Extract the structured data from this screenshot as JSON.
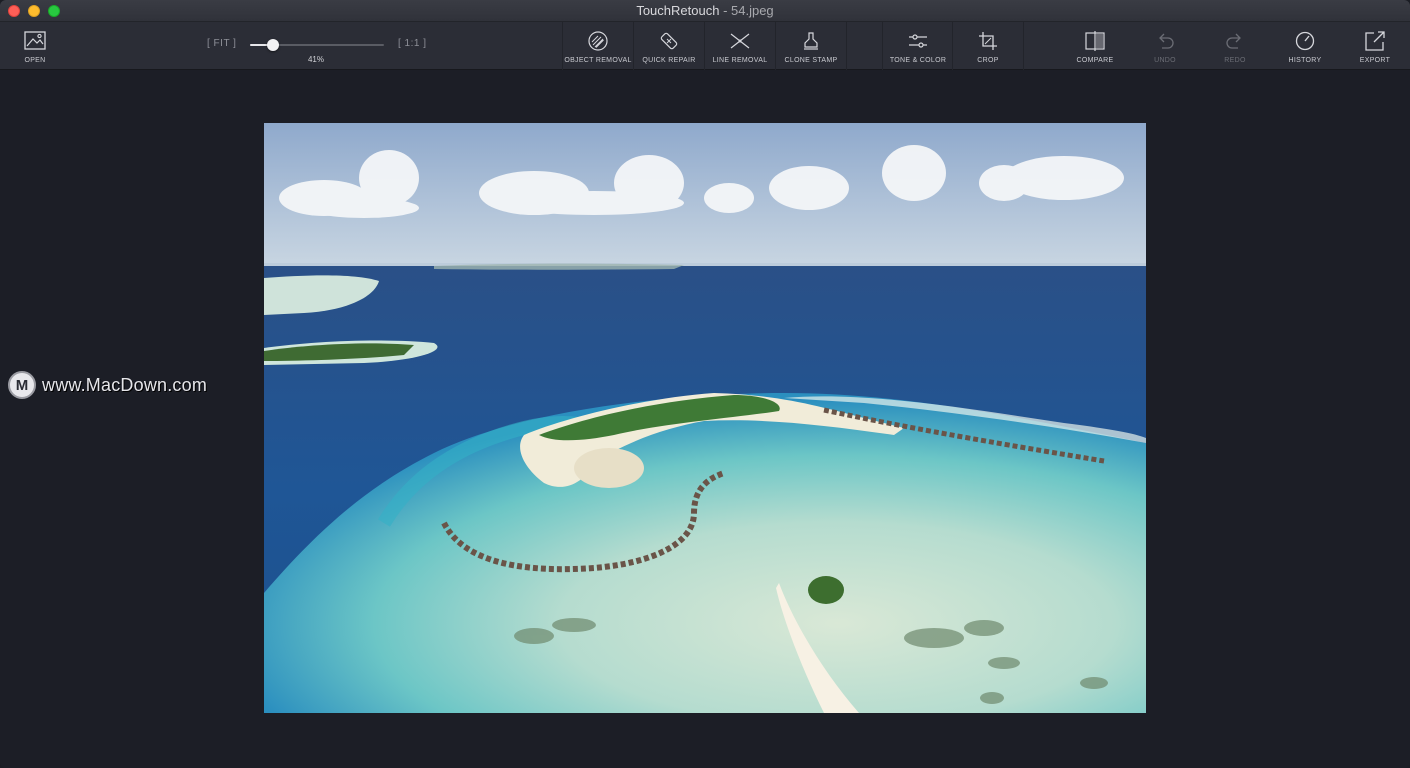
{
  "window": {
    "app_name": "TouchRetouch",
    "separator": " - ",
    "file_name": "54.jpeg"
  },
  "toolbar": {
    "open": {
      "label": "OPEN",
      "icon": "image-icon"
    },
    "zoom": {
      "fit_label": "[ FIT ]",
      "one_to_one_label": "[ 1:1 ]",
      "percent_label": "41%",
      "value": 0.17
    },
    "tools": [
      {
        "label": "OBJECT REMOVAL",
        "icon": "object-removal-icon"
      },
      {
        "label": "QUICK REPAIR",
        "icon": "bandage-icon"
      },
      {
        "label": "LINE REMOVAL",
        "icon": "line-removal-icon"
      },
      {
        "label": "CLONE STAMP",
        "icon": "clone-stamp-icon"
      },
      {
        "label": "TONE & COLOR",
        "icon": "sliders-icon"
      },
      {
        "label": "CROP",
        "icon": "crop-icon"
      }
    ],
    "compare": {
      "label": "COMPARE",
      "icon": "compare-icon"
    },
    "undo": {
      "label": "UNDO",
      "icon": "undo-icon",
      "enabled": false
    },
    "redo": {
      "label": "REDO",
      "icon": "redo-icon",
      "enabled": false
    },
    "history": {
      "label": "HISTORY",
      "icon": "history-icon"
    },
    "export": {
      "label": "EXPORT",
      "icon": "export-icon"
    }
  },
  "watermark": {
    "logo_letter": "M",
    "text": "www.MacDown.com"
  },
  "colors": {
    "background": "#1c1e26",
    "toolbar": "#2b2d36",
    "sky": "#9fb7d3",
    "ocean_deep": "#1f4f8c",
    "lagoon": "#8fd3c9"
  }
}
